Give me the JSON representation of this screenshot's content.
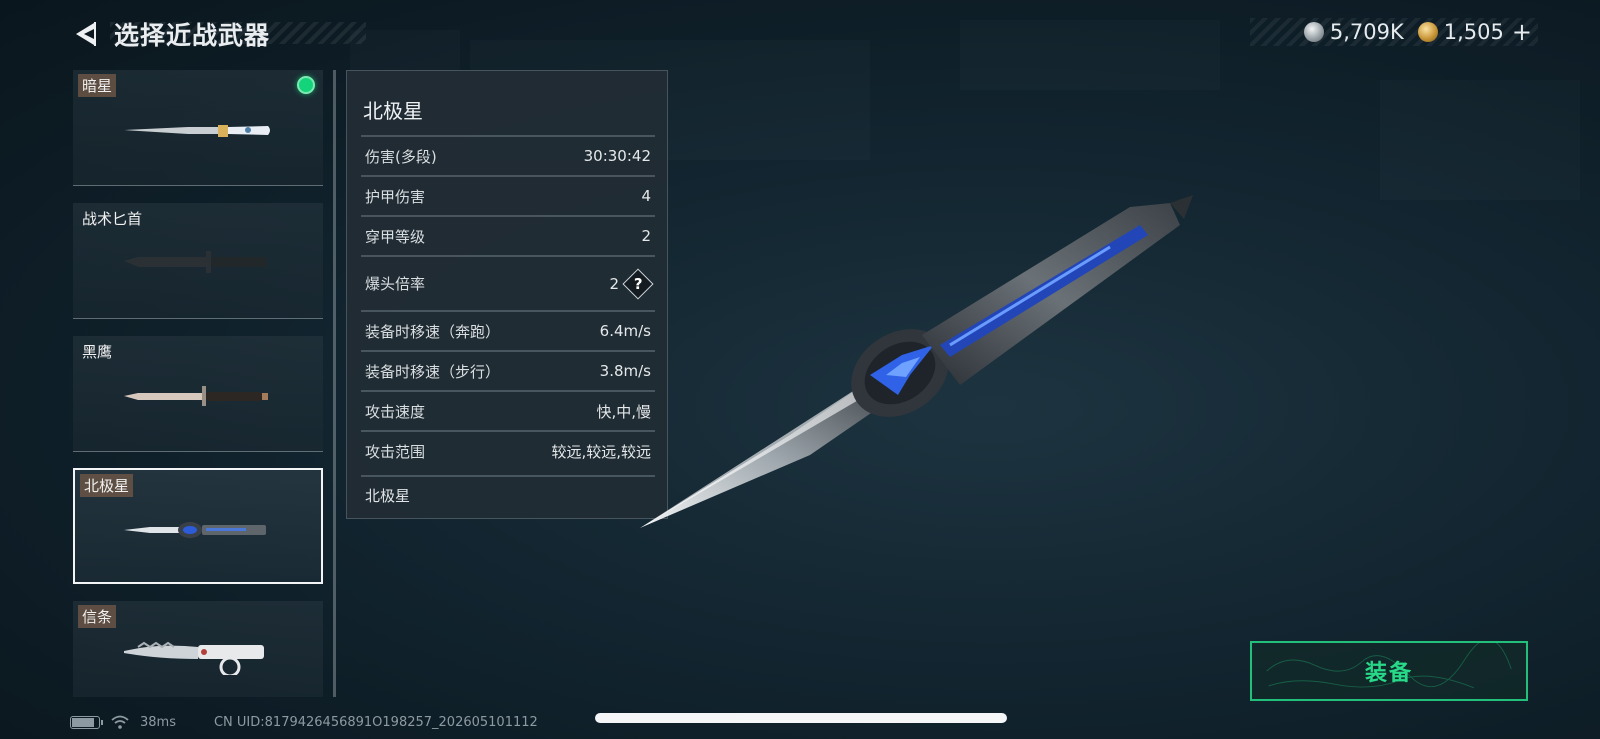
{
  "header": {
    "title": "选择近战武器"
  },
  "currency": [
    {
      "icon": "silver-coin-icon",
      "value": "5,709K"
    },
    {
      "icon": "gold-coin-icon",
      "value": "1,505"
    }
  ],
  "currency_plus": "+",
  "weapons": [
    {
      "name": "暗星",
      "tagged": true,
      "equipped": true
    },
    {
      "name": "战术匕首",
      "tagged": false,
      "equipped": false
    },
    {
      "name": "黑鹰",
      "tagged": false,
      "equipped": false
    },
    {
      "name": "北极星",
      "tagged": true,
      "equipped": false,
      "selected": true
    },
    {
      "name": "信条",
      "tagged": true,
      "equipped": false
    }
  ],
  "stats": {
    "title": "北极星",
    "rows": [
      {
        "label": "伤害(多段)",
        "value": "30:30:42"
      },
      {
        "label": "护甲伤害",
        "value": "4"
      },
      {
        "label": "穿甲等级",
        "value": "2"
      },
      {
        "label": "爆头倍率",
        "value": "2",
        "help": "?"
      },
      {
        "label": "装备时移速（奔跑）",
        "value": "6.4m/s"
      },
      {
        "label": "装备时移速（步行）",
        "value": "3.8m/s"
      },
      {
        "label": "攻击速度",
        "value": "快,中,慢"
      },
      {
        "label": "攻击范围",
        "value": "较远,较远,较远"
      }
    ],
    "footer": "北极星"
  },
  "equip_button": {
    "label": "装备",
    "color": "#27d989"
  },
  "status_bar": {
    "ping": "38ms",
    "uid": "CN UID:8179426456891O198257_202605101112",
    "battery_level": 0.85
  },
  "colors": {
    "accent_green": "#22c07a",
    "status_dot": "#13d47b"
  }
}
